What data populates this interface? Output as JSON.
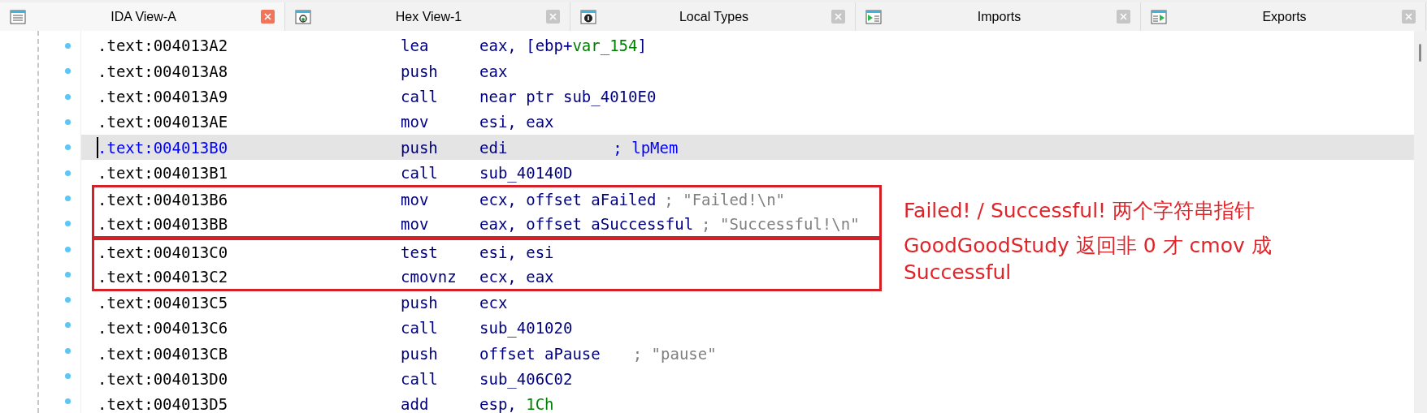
{
  "tabs": [
    {
      "label": "IDA View-A",
      "kind": "listing",
      "selected": true
    },
    {
      "label": "Hex View-1",
      "kind": "hex",
      "selected": false
    },
    {
      "label": "Local Types",
      "kind": "types",
      "selected": false
    },
    {
      "label": "Imports",
      "kind": "imports",
      "selected": false
    },
    {
      "label": "Exports",
      "kind": "exports",
      "selected": false
    }
  ],
  "listing": [
    {
      "kind": "line",
      "address": ".text:004013A2",
      "mnemonic": "lea",
      "selected": false,
      "operands": [
        {
          "kind": "plain",
          "text": "eax, [ebp+"
        },
        {
          "kind": "var",
          "text": "var_154"
        },
        {
          "kind": "plain",
          "text": "]"
        }
      ]
    },
    {
      "kind": "line",
      "address": ".text:004013A8",
      "mnemonic": "push",
      "selected": false,
      "operands": [
        {
          "kind": "plain",
          "text": "eax"
        }
      ]
    },
    {
      "kind": "line",
      "address": ".text:004013A9",
      "mnemonic": "call",
      "selected": false,
      "operands": [
        {
          "kind": "plain",
          "text": "near ptr sub_4010E0"
        }
      ]
    },
    {
      "kind": "line",
      "address": ".text:004013AE",
      "mnemonic": "mov",
      "selected": false,
      "operands": [
        {
          "kind": "plain",
          "text": "esi, eax"
        }
      ]
    },
    {
      "kind": "line",
      "address": ".text:004013B0",
      "mnemonic": "push",
      "selected": true,
      "operands": [
        {
          "kind": "plain",
          "text": "edi"
        }
      ],
      "comment": {
        "kind": "name",
        "text": "; lpMem"
      }
    },
    {
      "kind": "line",
      "address": ".text:004013B1",
      "mnemonic": "call",
      "selected": false,
      "operands": [
        {
          "kind": "plain",
          "text": "sub_40140D"
        }
      ]
    },
    {
      "kind": "boxed",
      "lines": [
        {
          "kind": "line",
          "address": ".text:004013B6",
          "mnemonic": "mov",
          "selected": false,
          "operands": [
            {
              "kind": "plain",
              "text": "ecx, offset aFailed"
            }
          ],
          "comment": {
            "kind": "string",
            "text": "; \"Failed!\\n\""
          }
        },
        {
          "kind": "line",
          "address": ".text:004013BB",
          "mnemonic": "mov",
          "selected": false,
          "operands": [
            {
              "kind": "plain",
              "text": "eax, offset aSuccessful"
            }
          ],
          "comment": {
            "kind": "string",
            "text": "; \"Successful!\\n\""
          }
        }
      ]
    },
    {
      "kind": "boxed",
      "lines": [
        {
          "kind": "line",
          "address": ".text:004013C0",
          "mnemonic": "test",
          "selected": false,
          "operands": [
            {
              "kind": "plain",
              "text": "esi, esi"
            }
          ]
        },
        {
          "kind": "line",
          "address": ".text:004013C2",
          "mnemonic": "cmovnz",
          "selected": false,
          "operands": [
            {
              "kind": "plain",
              "text": "ecx, eax"
            }
          ]
        }
      ]
    },
    {
      "kind": "line",
      "address": ".text:004013C5",
      "mnemonic": "push",
      "selected": false,
      "operands": [
        {
          "kind": "plain",
          "text": "ecx"
        }
      ]
    },
    {
      "kind": "line",
      "address": ".text:004013C6",
      "mnemonic": "call",
      "selected": false,
      "operands": [
        {
          "kind": "plain",
          "text": "sub_401020"
        }
      ]
    },
    {
      "kind": "line",
      "address": ".text:004013CB",
      "mnemonic": "push",
      "selected": false,
      "operands": [
        {
          "kind": "plain",
          "text": "offset aPause"
        }
      ],
      "comment": {
        "kind": "string",
        "text": "; \"pause\""
      }
    },
    {
      "kind": "line",
      "address": ".text:004013D0",
      "mnemonic": "call",
      "selected": false,
      "operands": [
        {
          "kind": "plain",
          "text": "sub_406C02"
        }
      ]
    },
    {
      "kind": "line",
      "address": ".text:004013D5",
      "mnemonic": "add",
      "selected": false,
      "operands": [
        {
          "kind": "plain",
          "text": "esp, "
        },
        {
          "kind": "num",
          "text": "1Ch"
        }
      ]
    }
  ],
  "annotations": [
    "Failed! / Successful! 两个字符串指针",
    "GoodGoodStudy 返回非 0 才 cmov 成 Successful"
  ]
}
